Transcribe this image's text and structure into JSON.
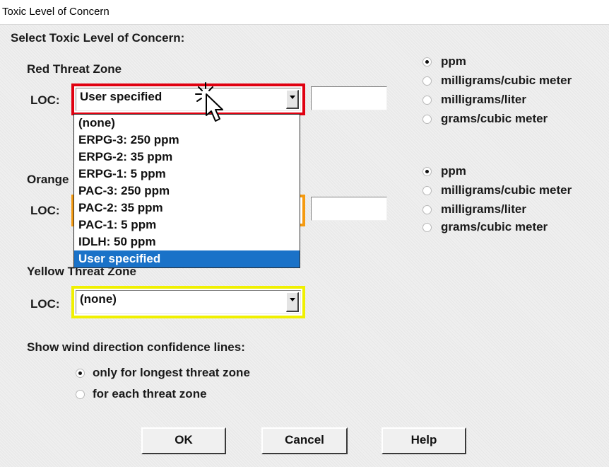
{
  "window": {
    "title": "Toxic Level of Concern"
  },
  "header": "Select Toxic Level of Concern:",
  "units": [
    "ppm",
    "milligrams/cubic meter",
    "milligrams/liter",
    "grams/cubic meter"
  ],
  "red_zone": {
    "label": "Red Threat Zone",
    "loc_label": "LOC:",
    "selected": "User specified",
    "custom_value": "",
    "selected_unit": "ppm"
  },
  "orange_zone": {
    "label_visible": "Orange",
    "loc_label": "LOC:",
    "custom_value": "",
    "selected_unit": "ppm"
  },
  "yellow_zone": {
    "label": "Yellow Threat Zone",
    "loc_label": "LOC:",
    "selected": "(none)"
  },
  "dropdown_options": [
    "(none)",
    "ERPG-3: 250 ppm",
    "ERPG-2: 35 ppm",
    "ERPG-1: 5 ppm",
    "PAC-3: 250 ppm",
    "PAC-2: 35 ppm",
    "PAC-1: 5 ppm",
    "IDLH: 50 ppm",
    "User specified"
  ],
  "dropdown_selected": "User specified",
  "wind": {
    "label": "Show wind direction confidence lines:",
    "options": [
      "only for longest threat zone",
      "for each threat zone"
    ],
    "selected": "only for longest threat zone"
  },
  "buttons": {
    "ok": "OK",
    "cancel": "Cancel",
    "help": "Help"
  },
  "colors": {
    "red": "#e00010",
    "orange": "#f59a10",
    "yellow": "#f0f000",
    "selection": "#1a72c8"
  }
}
